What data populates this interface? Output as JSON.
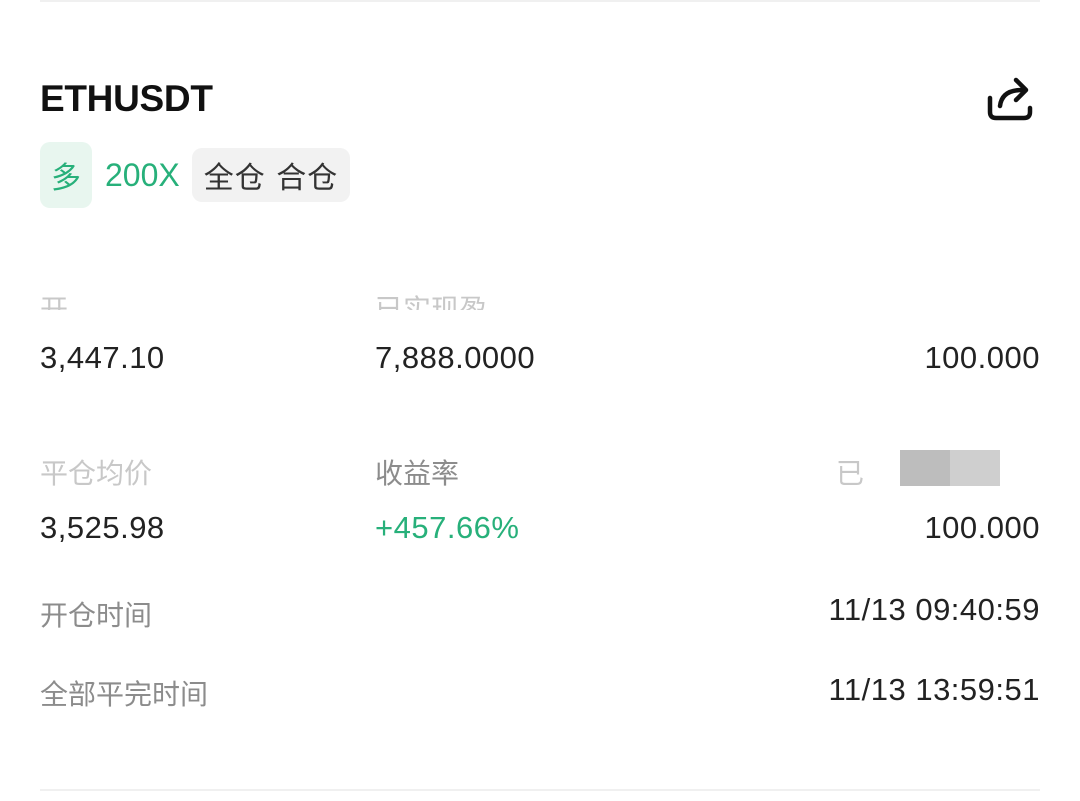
{
  "header": {
    "symbol": "ETHUSDT",
    "share_icon": "share-icon"
  },
  "tags": {
    "side": "多",
    "leverage": "200X",
    "margin_mode": "全仓 合仓"
  },
  "stats": {
    "open_avg_price_label": "开",
    "open_avg_price_value": "3,447.10",
    "realized_pnl_label": "已实现盈",
    "realized_pnl_value": "7,888.0000",
    "qty_label": "",
    "qty_value": "100.000",
    "close_avg_price_label": "平仓均价",
    "close_avg_price_value": "3,525.98",
    "roi_label": "收益率",
    "roi_value": "+457.66%",
    "closed_qty_label": "已",
    "closed_qty_value": "100.000"
  },
  "times": {
    "open_time_label": "开仓时间",
    "open_time_value": "11/13 09:40:59",
    "close_time_label": "全部平完时间",
    "close_time_value": "11/13 13:59:51"
  },
  "colors": {
    "accent_green": "#27b07a",
    "tag_green_bg": "#e8f6ef",
    "tag_grey_bg": "#f2f2f2"
  }
}
